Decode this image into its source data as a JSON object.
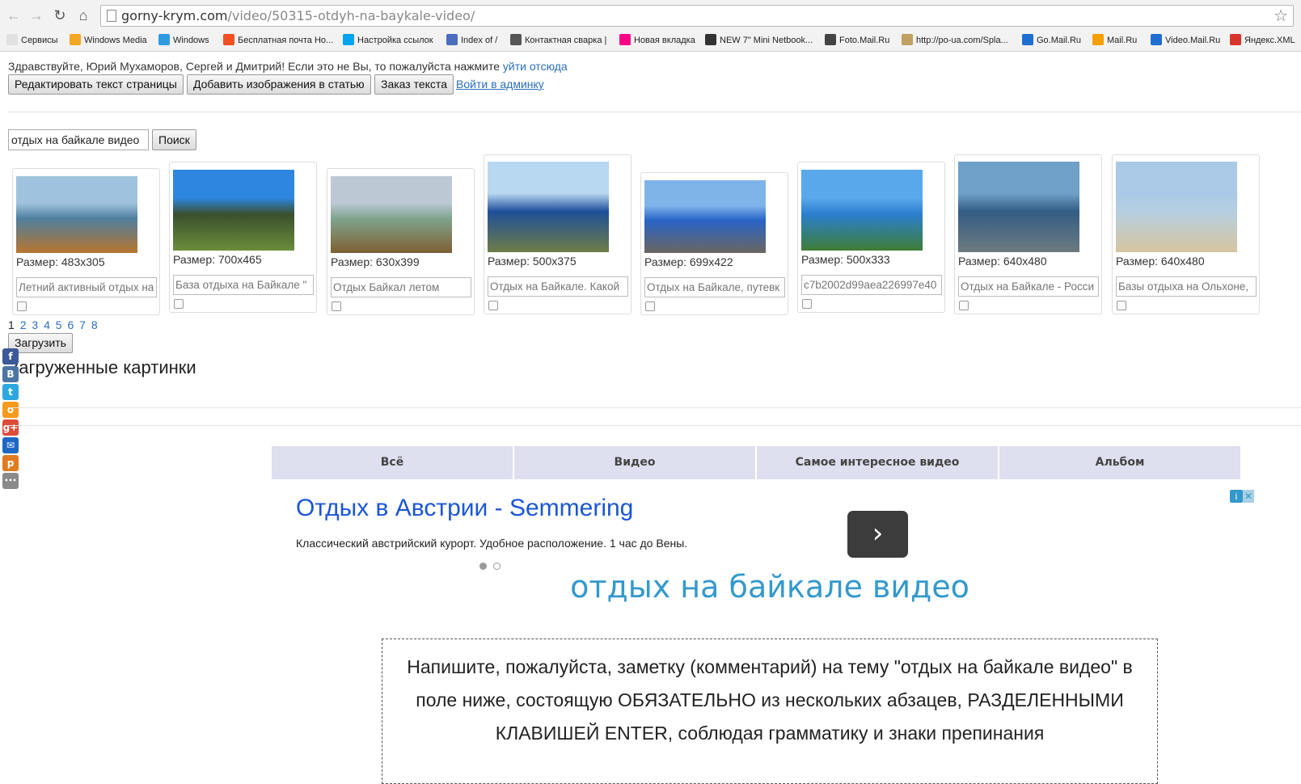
{
  "browser": {
    "url_host": "gorny-krym.com",
    "url_path": "/video/50315-otdyh-na-baykale-video/",
    "bookmarks": [
      {
        "label": "Сервисы",
        "color": "#e0e0e0"
      },
      {
        "label": "Windows Media",
        "color": "#f5a623"
      },
      {
        "label": "Windows",
        "color": "#2e9be0"
      },
      {
        "label": "Бесплатная почта Ho...",
        "color": "#f25022"
      },
      {
        "label": "Настройка ссылок",
        "color": "#00a4ef"
      },
      {
        "label": "Index of /",
        "color": "#4a6ebd"
      },
      {
        "label": "Контактная сварка |",
        "color": "#555555"
      },
      {
        "label": "Новая вкладка",
        "color": "#ff0084"
      },
      {
        "label": "NEW 7\" Mini Netbook...",
        "color": "#333333"
      },
      {
        "label": "Foto.Mail.Ru",
        "color": "#444444"
      },
      {
        "label": "http://po-ua.com/Spla...",
        "color": "#c0a060"
      },
      {
        "label": "Go.Mail.Ru",
        "color": "#1f6fd0"
      },
      {
        "label": "Mail.Ru",
        "color": "#f5a000"
      },
      {
        "label": "Video.Mail.Ru",
        "color": "#1f6fd0"
      },
      {
        "label": "Яндекс.XML",
        "color": "#d9342b"
      }
    ]
  },
  "header": {
    "greeting": "Здравствуйте, Юрий Мухаморов, Сергей и Дмитрий! Если это не Вы, то пожалуйста нажмите",
    "logout_link": "уйти отсюда",
    "edit_button": "Редактировать текст страницы",
    "add_images_button": "Добавить изображения в статью",
    "order_button": "Заказ текста",
    "admin_link": "Войти в админку"
  },
  "search": {
    "value": "отдых на байкале видео",
    "button": "Поиск"
  },
  "images": [
    {
      "size": "Размер: 483x305",
      "alt": "Летний активный отдых на",
      "sky": "#9fc3de",
      "ground": "#b9752e",
      "water": "#4f7f9e"
    },
    {
      "size": "Размер: 700x465",
      "alt": "База отдыха на Байкале \"",
      "sky": "#2e86e0",
      "ground": "#6a8d3a",
      "water": "#3b4f2e"
    },
    {
      "size": "Размер: 630x399",
      "alt": "Отдых Байкал летом",
      "sky": "#bcc8d4",
      "ground": "#7e5f32",
      "water": "#7fa48e"
    },
    {
      "size": "Размер: 500x375",
      "alt": "Отдых на Байкале. Какой",
      "sky": "#b8d7f0",
      "ground": "#6f7d46",
      "water": "#1e4f9a"
    },
    {
      "size": "Размер: 699x422",
      "alt": "Отдых на Байкале, путевк",
      "sky": "#7fb4e8",
      "ground": "#6b6660",
      "water": "#2864c8"
    },
    {
      "size": "Размер: 500x333",
      "alt": "c7b2002d99aea226997e40",
      "sky": "#5aa8ec",
      "ground": "#3f7d34",
      "water": "#2b7fd0"
    },
    {
      "size": "Размер: 640x480",
      "alt": "Отдых на Байкале - Росси",
      "sky": "#6fa0c8",
      "ground": "#6d7a80",
      "water": "#335d84"
    },
    {
      "size": "Размер: 640x480",
      "alt": "Базы отдыха на Ольхоне,",
      "sky": "#a9c9e6",
      "ground": "#d6c4a0",
      "water": "#b6cfe0"
    }
  ],
  "pager": {
    "current": "1",
    "pages": [
      "2",
      "3",
      "4",
      "5",
      "6",
      "7",
      "8"
    ]
  },
  "upload_button": "Загрузить",
  "uploaded_title": "Загруженные картинки",
  "social": [
    {
      "icon": "facebook-icon",
      "glyph": "f",
      "color": "#3b5998"
    },
    {
      "icon": "vk-icon",
      "glyph": "В",
      "color": "#4c75a3"
    },
    {
      "icon": "twitter-icon",
      "glyph": "t",
      "color": "#2ca7e0"
    },
    {
      "icon": "odnoklassniki-icon",
      "glyph": "о",
      "color": "#f59a1b"
    },
    {
      "icon": "google-plus-icon",
      "glyph": "g+",
      "color": "#dd4b39"
    },
    {
      "icon": "mail-icon",
      "glyph": "✉",
      "color": "#1f68c4"
    },
    {
      "icon": "pinterest-icon",
      "glyph": "p",
      "color": "#e07b1f"
    },
    {
      "icon": "more-icon",
      "glyph": "•••",
      "color": "#8a8a8a"
    }
  ],
  "tabs": [
    "Всё",
    "Видео",
    "Самое интересное видео",
    "Альбом"
  ],
  "ad": {
    "title": "Отдых в Австрии - Semmering",
    "description": "Классический австрийский курорт. Удобное расположение. 1 час до Вены.",
    "go_glyph": "›",
    "adchoices": "ⓘ✕"
  },
  "page_title": "отдых на байкале видео",
  "note_text": "Напишите, пожалуйста, заметку (комментарий) на тему \"отдых на байкале видео\" в поле ниже, состоящую ОБЯЗАТЕЛЬНО из нескольких абзацев, РАЗДЕЛЕННЫМИ КЛАВИШЕЙ ENTER, соблюдая грамматику и знаки препинания"
}
